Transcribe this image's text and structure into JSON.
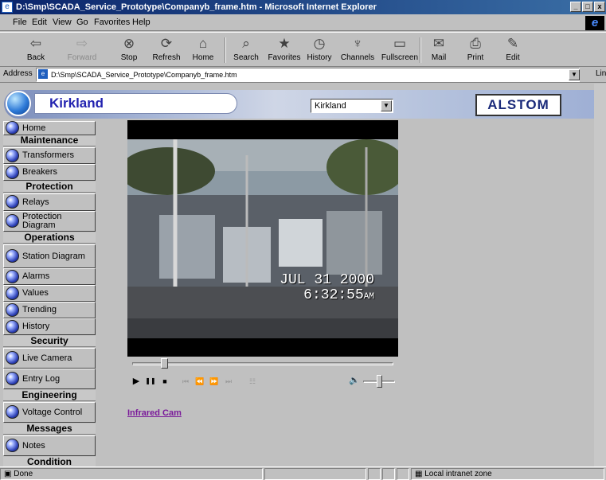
{
  "window": {
    "title": "D:\\Smp\\SCADA_Service_Prototype\\Companyb_frame.htm - Microsoft Internet Explorer",
    "controls": [
      "_",
      "□",
      "x"
    ]
  },
  "menu": [
    "File",
    "Edit",
    "View",
    "Go",
    "Favorites",
    "Help"
  ],
  "toolbar": [
    {
      "label": "Back",
      "icon": "back-arrow-icon",
      "glyph": "⇦"
    },
    {
      "label": "Forward",
      "icon": "forward-arrow-icon",
      "glyph": "⇨"
    },
    {
      "label": "Stop",
      "icon": "stop-icon",
      "glyph": "⊗"
    },
    {
      "label": "Refresh",
      "icon": "refresh-icon",
      "glyph": "⟳"
    },
    {
      "label": "Home",
      "icon": "home-icon",
      "glyph": "⌂"
    },
    {
      "label": "Search",
      "icon": "search-icon",
      "glyph": "⌕"
    },
    {
      "label": "Favorites",
      "icon": "favorites-icon",
      "glyph": "★"
    },
    {
      "label": "History",
      "icon": "history-icon",
      "glyph": "◷"
    },
    {
      "label": "Channels",
      "icon": "channels-icon",
      "glyph": "♆"
    },
    {
      "label": "Fullscreen",
      "icon": "fullscreen-icon",
      "glyph": "▭"
    },
    {
      "label": "Mail",
      "icon": "mail-icon",
      "glyph": "✉"
    },
    {
      "label": "Print",
      "icon": "print-icon",
      "glyph": "⎙"
    },
    {
      "label": "Edit",
      "icon": "edit-icon",
      "glyph": "✎"
    }
  ],
  "address": {
    "label": "Address",
    "value": "D:\\Smp\\SCADA_Service_Prototype\\Companyb_frame.htm",
    "links": "Links"
  },
  "banner": {
    "site_name": "Kirkland",
    "site_select": "Kirkland",
    "brand": "ALSTOM",
    "accent": "#2323b0"
  },
  "nav": {
    "home": "Home",
    "maintenance": "Maintenance",
    "transformers": "Transformers",
    "breakers": "Breakers",
    "protection": "Protection",
    "relays": "Relays",
    "protection_diagram": "Protection Diagram",
    "operations": "Operations",
    "station_diagram": "Station Diagram",
    "alarms": "Alarms",
    "values": "Values",
    "trending": "Trending",
    "history": "History",
    "security": "Security",
    "live_camera": "Live Camera",
    "entry_log": "Entry Log",
    "engineering": "Engineering",
    "voltage_control": "Voltage Control",
    "messages": "Messages",
    "notes": "Notes",
    "condition": "Condition"
  },
  "video": {
    "date": "JUL 31 2000",
    "time": "6:32:55",
    "ampm": "AM"
  },
  "player": {
    "play": "▶",
    "pause": "❚❚",
    "stop": "■",
    "skip_back": "⏮",
    "rewind": "⏪",
    "fast_forward": "⏩",
    "skip_forward": "⏭",
    "playlist": "☷",
    "volume_icon": "🔈"
  },
  "infrared_link": "Infrared Cam",
  "status": {
    "text": "Done",
    "zone": "Local intranet zone"
  }
}
